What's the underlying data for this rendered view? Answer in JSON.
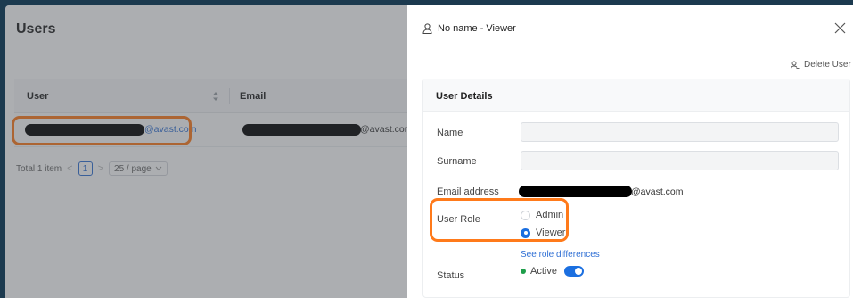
{
  "page": {
    "title": "Users"
  },
  "table": {
    "columns": [
      "User",
      "Email"
    ],
    "rows": [
      {
        "user_domain": "@avast.com",
        "email_domain": "@avast.com"
      }
    ]
  },
  "pagination": {
    "total": "Total 1 item",
    "prev": "<",
    "current": "1",
    "next": ">",
    "page_size": "25 / page"
  },
  "drawer": {
    "title": "No name - Viewer",
    "delete_label": "Delete User",
    "card_title": "User Details",
    "fields": {
      "name_label": "Name",
      "surname_label": "Surname",
      "email_label": "Email address",
      "email_domain": "@avast.com",
      "role_label": "User Role",
      "role_options": [
        "Admin",
        "Viewer"
      ],
      "selected_role": "Viewer",
      "role_link": "See role differences",
      "status_label": "Status",
      "status_value": "Active"
    }
  },
  "colors": {
    "frame": "#1c3a4f",
    "accent": "#1b6fe0",
    "highlight": "#ff7a1a",
    "status_active": "#1e9e4a"
  },
  "icons": {
    "drawer_user": "user-icon",
    "close": "close-icon",
    "delete": "user-delete-icon",
    "sort": "sort-icon",
    "dropdown": "chevron-down-icon"
  }
}
